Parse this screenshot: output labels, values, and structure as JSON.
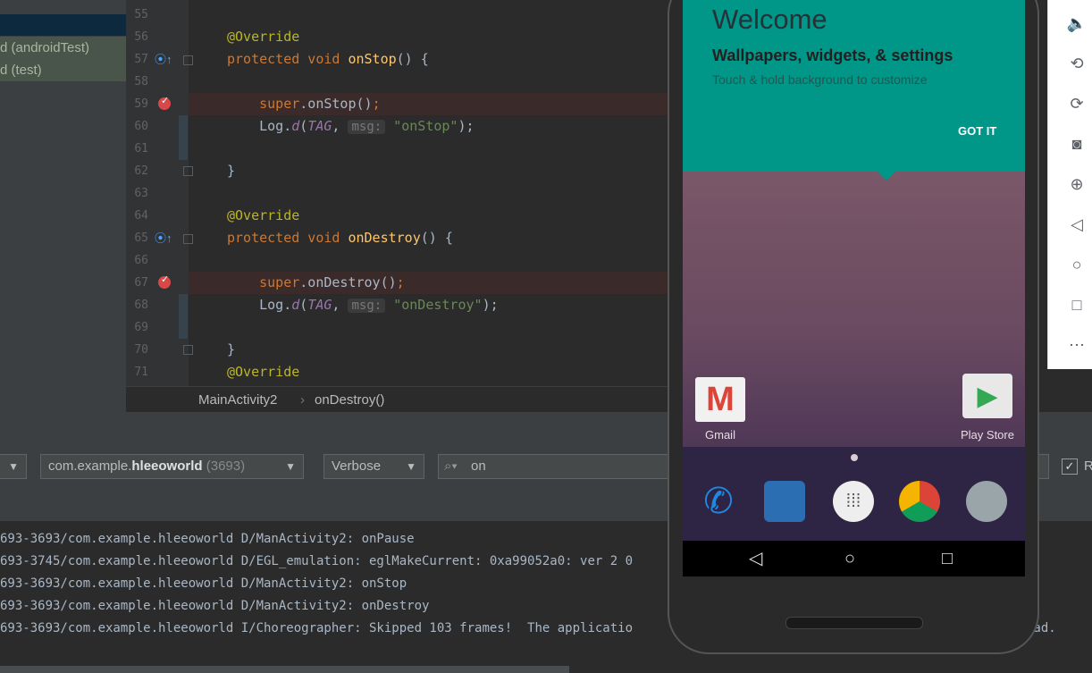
{
  "project_tree": {
    "items": [
      "d (androidTest)",
      "d (test)"
    ]
  },
  "editor": {
    "lines": [
      {
        "n": "55",
        "tokens": []
      },
      {
        "n": "56",
        "tokens": [
          {
            "c": "ann",
            "t": "@Override"
          }
        ]
      },
      {
        "n": "57",
        "tokens": [
          {
            "c": "kw",
            "t": "protected void "
          },
          {
            "c": "fn",
            "t": "onStop"
          },
          {
            "c": "",
            "t": "() {"
          }
        ]
      },
      {
        "n": "58",
        "tokens": []
      },
      {
        "n": "59",
        "tokens": [
          {
            "c": "kw",
            "t": "    super"
          },
          {
            "c": "",
            "t": ".onStop()"
          },
          {
            "c": "kw",
            "t": ";"
          }
        ]
      },
      {
        "n": "60",
        "tokens": [
          {
            "c": "",
            "t": "    Log."
          },
          {
            "c": "it",
            "t": "d"
          },
          {
            "c": "",
            "t": "("
          },
          {
            "c": "it",
            "t": "TAG"
          },
          {
            "c": "",
            "t": ", "
          },
          {
            "c": "hint",
            "t": "msg:"
          },
          {
            "c": "",
            "t": " "
          },
          {
            "c": "str",
            "t": "\"onStop\""
          },
          {
            "c": "",
            "t": ");"
          }
        ]
      },
      {
        "n": "61",
        "tokens": []
      },
      {
        "n": "62",
        "tokens": [
          {
            "c": "",
            "t": "}"
          }
        ]
      },
      {
        "n": "63",
        "tokens": []
      },
      {
        "n": "64",
        "tokens": [
          {
            "c": "ann",
            "t": "@Override"
          }
        ]
      },
      {
        "n": "65",
        "tokens": [
          {
            "c": "kw",
            "t": "protected void "
          },
          {
            "c": "fn",
            "t": "onDestroy"
          },
          {
            "c": "",
            "t": "() {"
          }
        ]
      },
      {
        "n": "66",
        "tokens": []
      },
      {
        "n": "67",
        "tokens": [
          {
            "c": "kw",
            "t": "    super"
          },
          {
            "c": "",
            "t": ".onDestroy()"
          },
          {
            "c": "kw",
            "t": ";"
          }
        ]
      },
      {
        "n": "68",
        "tokens": [
          {
            "c": "",
            "t": "    Log."
          },
          {
            "c": "it",
            "t": "d"
          },
          {
            "c": "",
            "t": "("
          },
          {
            "c": "it",
            "t": "TAG"
          },
          {
            "c": "",
            "t": ", "
          },
          {
            "c": "hint",
            "t": "msg:"
          },
          {
            "c": "",
            "t": " "
          },
          {
            "c": "str",
            "t": "\"onDestroy\""
          },
          {
            "c": "",
            "t": ");"
          }
        ]
      },
      {
        "n": "69",
        "tokens": []
      },
      {
        "n": "70",
        "tokens": [
          {
            "c": "",
            "t": "}"
          }
        ]
      },
      {
        "n": "71",
        "tokens": [
          {
            "c": "ann",
            "t": "@Override"
          }
        ]
      }
    ]
  },
  "breadcrumb": {
    "class_name": "MainActivity2",
    "separator": "›",
    "method_name": "onDestroy()"
  },
  "logcat": {
    "process_prefix": "com.example.",
    "process_bold": "hleeoworld",
    "process_pid": "(3693)",
    "level": "Verbose",
    "search_value": "on",
    "regex_label": "R",
    "lines": [
      "693-3693/com.example.hleeoworld D/ManActivity2: onPause",
      "693-3745/com.example.hleeoworld D/EGL_emulation: eglMakeCurrent: 0xa99052a0: ver 2 0",
      "693-3693/com.example.hleeoworld D/ManActivity2: onStop",
      "693-3693/com.example.hleeoworld D/ManActivity2: onDestroy",
      "693-3693/com.example.hleeoworld I/Choreographer: Skipped 103 frames!  The applicatio"
    ],
    "line_tail": "ead."
  },
  "emulator": {
    "welcome_title": "Welcome",
    "welcome_subtitle": "Wallpapers, widgets, & settings",
    "welcome_desc": "Touch & hold background to customize",
    "got_it": "GOT IT",
    "apps": [
      "Gmail",
      "Play Store"
    ],
    "side_icons": [
      "volume-icon",
      "rotate-left-icon",
      "rotate-right-icon",
      "camera-icon",
      "zoom-icon",
      "back-icon",
      "home-icon",
      "overview-icon",
      "more-icon"
    ]
  }
}
